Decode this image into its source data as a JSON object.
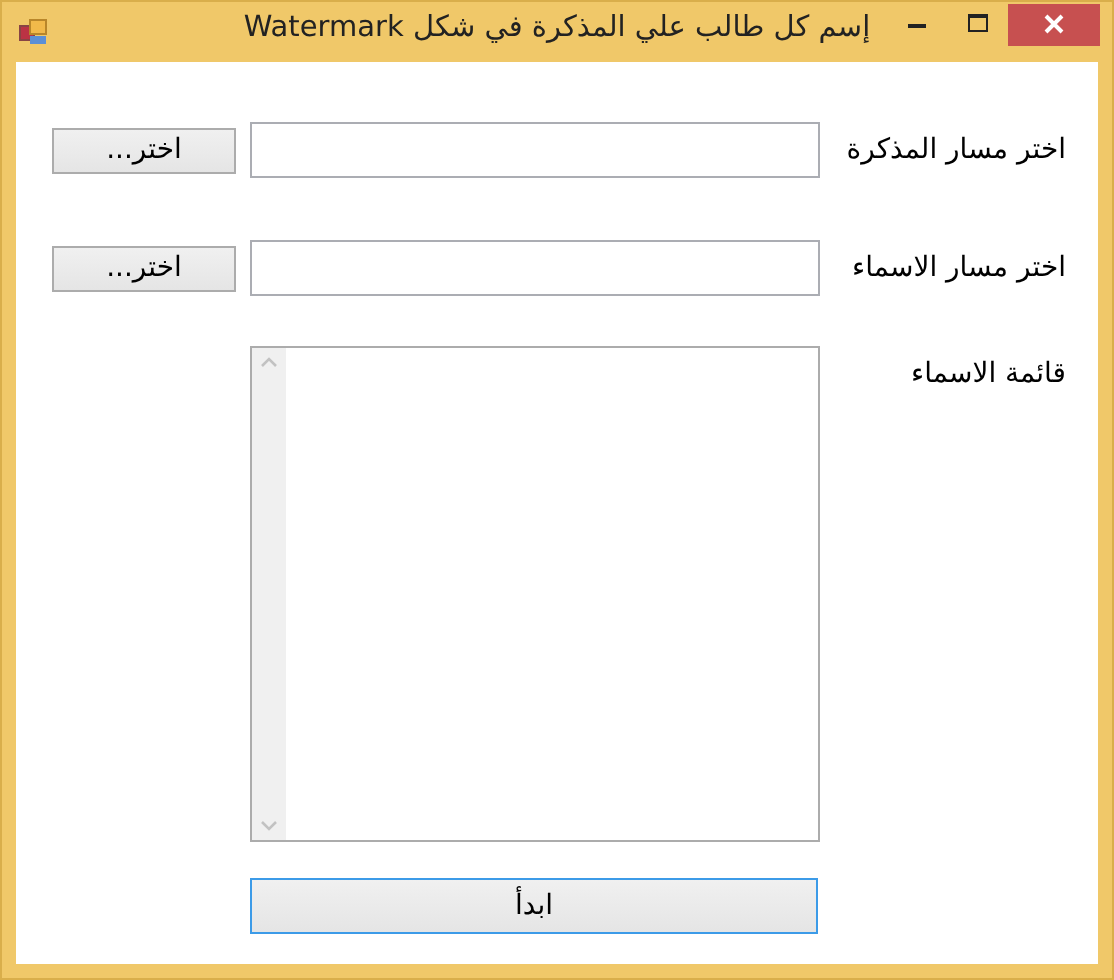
{
  "window": {
    "title": "إسم كل طالب علي المذكرة في شكل Watermark"
  },
  "rows": [
    {
      "label": "اختر مسار المذكرة",
      "button": "اختر..."
    },
    {
      "label": "اختر مسار الاسماء",
      "button": "اختر..."
    }
  ],
  "names_list": {
    "label": "قائمة الاسماء"
  },
  "start_button": {
    "label": "ابدأ",
    "focused": true
  }
}
